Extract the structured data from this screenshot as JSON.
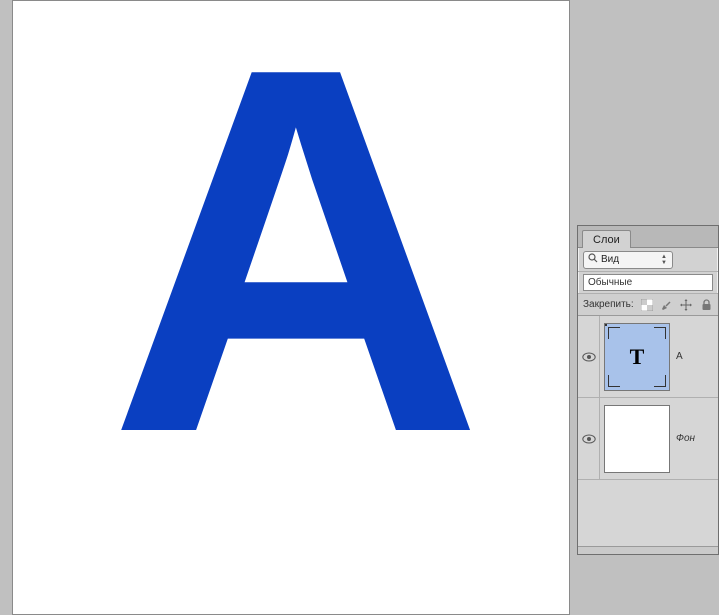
{
  "canvas": {
    "letter": "А",
    "letter_color": "#0a3fc1"
  },
  "panel": {
    "tab_label": "Слои",
    "filter": {
      "mode_label": "Вид"
    },
    "blend_mode": "Обычные",
    "lock": {
      "label": "Закрепить:"
    },
    "layers": [
      {
        "name": "A",
        "type": "text",
        "visible": true,
        "selected": true,
        "thumb_glyph": "T"
      },
      {
        "name": "Фон",
        "type": "background",
        "visible": true,
        "selected": false,
        "italic": true
      }
    ]
  }
}
